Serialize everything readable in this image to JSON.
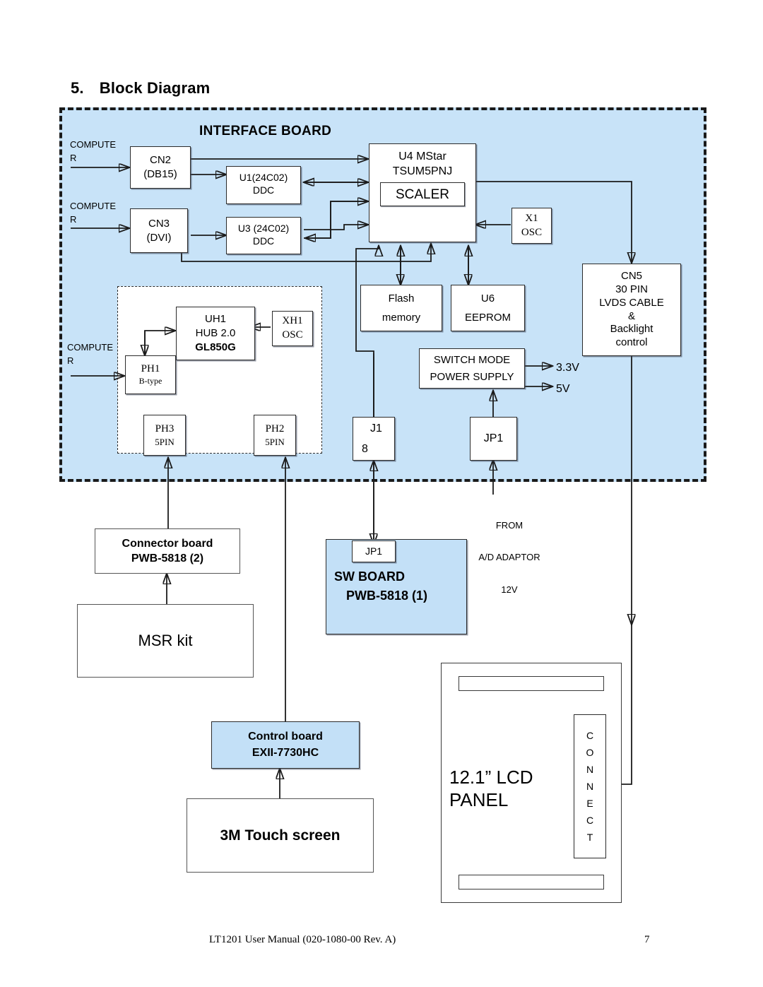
{
  "title": {
    "number": "5.",
    "text": "Block Diagram"
  },
  "interface_board": {
    "label": "INTERFACE BOARD",
    "inputs": [
      {
        "line1": "COMPUTE",
        "line2": "R"
      },
      {
        "line1": "COMPUTE",
        "line2": "R"
      },
      {
        "line1": "COMPUTE",
        "line2": "R"
      }
    ],
    "blocks": {
      "cn2": {
        "line1": "CN2",
        "line2": "(DB15)"
      },
      "cn3": {
        "line1": "CN3",
        "line2": "(DVI)"
      },
      "u1": {
        "line1": "U1(24C02)",
        "line2": "DDC"
      },
      "u3": {
        "line1": "U3 (24C02)",
        "line2": "DDC"
      },
      "u4": {
        "line1": "U4 MStar",
        "line2": "TSUM5PNJ",
        "inner": "SCALER"
      },
      "x1": {
        "line1": "X1",
        "line2": "OSC"
      },
      "flash": {
        "line1": "Flash",
        "line2": "memory"
      },
      "u6": {
        "line1": "U6",
        "line2": "EEPROM"
      },
      "cn5": {
        "line1": "CN5",
        "line2": "30 PIN",
        "line3": "LVDS CABLE",
        "line4": "&",
        "line5": "Backlight",
        "line6": "control"
      },
      "uh1": {
        "line1": "UH1",
        "line2": "HUB 2.0",
        "line3": "GL850G"
      },
      "xh1": {
        "line1": "XH1",
        "line2": "OSC"
      },
      "ph1": {
        "line1": "PH1",
        "line2": "B-type"
      },
      "ph3": {
        "line1": "PH3",
        "line2": "5PIN"
      },
      "ph2": {
        "line1": "PH2",
        "line2": "5PIN"
      },
      "smps": {
        "line1": "SWITCH MODE",
        "line2": "POWER SUPPLY"
      },
      "j1": {
        "line1": "J1",
        "line2": "8"
      },
      "jp1": {
        "line1": "JP1"
      }
    },
    "power_rails": {
      "rail_1": "3.3V",
      "rail_2": "5V"
    }
  },
  "external": {
    "power_source": {
      "line1": "FROM",
      "line2": "A/D ADAPTOR",
      "line3": "12V"
    },
    "connector_board": {
      "line1": "Connector board",
      "line2": "PWB‑5818 (2)"
    },
    "msr_kit": {
      "label": "MSR kit"
    },
    "sw_board": {
      "jp1": "JP1",
      "line1": "SW BOARD",
      "line2": "PWB-5818 (1)"
    },
    "control_board": {
      "line1": "Control board",
      "line2": "EXII‑7730HC"
    },
    "touch_screen": {
      "label": "3M Touch screen"
    },
    "lcd_panel": {
      "label": "12.1” LCD\nPANEL",
      "connector_letters": [
        "C",
        "O",
        "N",
        "N",
        "E",
        "C",
        "T"
      ]
    }
  },
  "footer": {
    "document": "LT1201 User Manual (020-1080-00 Rev. A)",
    "page": "7"
  },
  "colors": {
    "board_fill": "#c8e3f8",
    "board_border": "#1a1a1a",
    "box_border": "#2b2b2b",
    "blue_board": "#c3e0f7"
  }
}
